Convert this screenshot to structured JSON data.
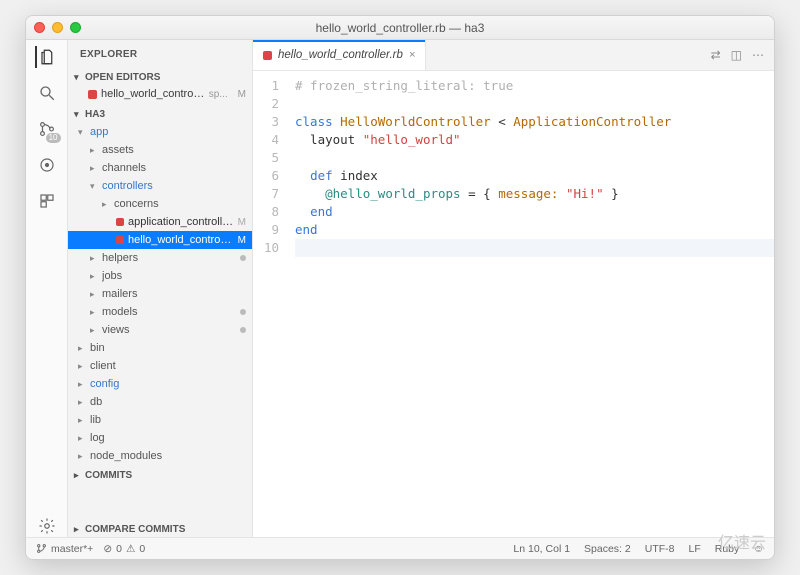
{
  "window": {
    "title": "hello_world_controller.rb — ha3"
  },
  "sidebar": {
    "header": "EXPLORER",
    "open_editors": {
      "title": "OPEN EDITORS",
      "items": [
        {
          "label": "hello_world_controller.rb",
          "suffix": "sp...",
          "badge": "M"
        }
      ]
    },
    "project": {
      "title": "HA3",
      "tree": [
        {
          "type": "folder",
          "name": "app",
          "depth": 0,
          "open": true,
          "color": "blue"
        },
        {
          "type": "folder",
          "name": "assets",
          "depth": 1,
          "open": false,
          "color": "plain"
        },
        {
          "type": "folder",
          "name": "channels",
          "depth": 1,
          "open": false,
          "color": "plain"
        },
        {
          "type": "folder",
          "name": "controllers",
          "depth": 1,
          "open": true,
          "color": "blue"
        },
        {
          "type": "folder",
          "name": "concerns",
          "depth": 2,
          "open": false,
          "color": "plain"
        },
        {
          "type": "file",
          "name": "application_controller.rb",
          "depth": 2,
          "badge": "M"
        },
        {
          "type": "file",
          "name": "hello_world_controller.rb",
          "depth": 2,
          "badge": "M",
          "selected": true
        },
        {
          "type": "folder",
          "name": "helpers",
          "depth": 1,
          "open": false,
          "color": "plain",
          "mod": true
        },
        {
          "type": "folder",
          "name": "jobs",
          "depth": 1,
          "open": false,
          "color": "plain"
        },
        {
          "type": "folder",
          "name": "mailers",
          "depth": 1,
          "open": false,
          "color": "plain"
        },
        {
          "type": "folder",
          "name": "models",
          "depth": 1,
          "open": false,
          "color": "plain",
          "mod": true
        },
        {
          "type": "folder",
          "name": "views",
          "depth": 1,
          "open": false,
          "color": "plain",
          "mod": true
        },
        {
          "type": "folder",
          "name": "bin",
          "depth": 0,
          "open": false,
          "color": "plain"
        },
        {
          "type": "folder",
          "name": "client",
          "depth": 0,
          "open": false,
          "color": "plain"
        },
        {
          "type": "folder",
          "name": "config",
          "depth": 0,
          "open": false,
          "color": "blue"
        },
        {
          "type": "folder",
          "name": "db",
          "depth": 0,
          "open": false,
          "color": "plain"
        },
        {
          "type": "folder",
          "name": "lib",
          "depth": 0,
          "open": false,
          "color": "plain"
        },
        {
          "type": "folder",
          "name": "log",
          "depth": 0,
          "open": false,
          "color": "plain"
        },
        {
          "type": "folder",
          "name": "node_modules",
          "depth": 0,
          "open": false,
          "color": "plain"
        }
      ]
    },
    "commits": "COMMITS",
    "compare": "COMPARE COMMITS"
  },
  "tab": {
    "label": "hello_world_controller.rb"
  },
  "code": {
    "lines": [
      {
        "raw": "# frozen_string_literal: true",
        "tokens": [
          [
            "comment",
            "# frozen_string_literal: true"
          ]
        ]
      },
      {
        "raw": "",
        "tokens": []
      },
      {
        "raw": "class HelloWorldController < ApplicationController",
        "tokens": [
          [
            "kw",
            "class "
          ],
          [
            "class",
            "HelloWorldController"
          ],
          [
            "plain",
            " < "
          ],
          [
            "const",
            "ApplicationController"
          ]
        ]
      },
      {
        "raw": "  layout \"hello_world\"",
        "tokens": [
          [
            "plain",
            "  layout "
          ],
          [
            "str",
            "\"hello_world\""
          ]
        ]
      },
      {
        "raw": "",
        "tokens": []
      },
      {
        "raw": "  def index",
        "tokens": [
          [
            "plain",
            "  "
          ],
          [
            "kw",
            "def "
          ],
          [
            "plain",
            "index"
          ]
        ]
      },
      {
        "raw": "    @hello_world_props = { message: \"Hi!\" }",
        "tokens": [
          [
            "plain",
            "    "
          ],
          [
            "ivar",
            "@hello_world_props"
          ],
          [
            "plain",
            " = { "
          ],
          [
            "sym",
            "message:"
          ],
          [
            "plain",
            " "
          ],
          [
            "str",
            "\"Hi!\""
          ],
          [
            "plain",
            " }"
          ]
        ]
      },
      {
        "raw": "  end",
        "tokens": [
          [
            "plain",
            "  "
          ],
          [
            "kw",
            "end"
          ]
        ]
      },
      {
        "raw": "end",
        "tokens": [
          [
            "kw",
            "end"
          ]
        ]
      },
      {
        "raw": "",
        "tokens": [],
        "hl": true
      }
    ]
  },
  "status": {
    "branch": "master*+",
    "errors": "0",
    "warnings": "0",
    "lncol": "Ln 10, Col 1",
    "spaces": "Spaces: 2",
    "encoding": "UTF-8",
    "eol": "LF",
    "lang": "Ruby"
  },
  "activity_badge": "10",
  "watermark": "亿速云"
}
